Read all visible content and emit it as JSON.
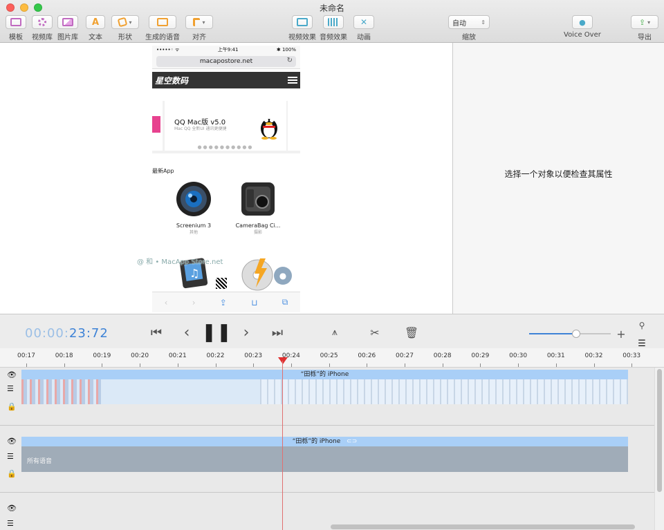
{
  "window": {
    "title": "未命名"
  },
  "toolbar": {
    "templates": "模板",
    "video_library": "视频库",
    "image_library": "图片库",
    "text": "文本",
    "shapes": "形状",
    "generated_voice": "生成的语音",
    "align": "对齐",
    "video_effects": "视频效果",
    "audio_effects": "音频效果",
    "animation": "动画",
    "zoom_value": "自动",
    "zoom": "缩放",
    "voice_over": "Voice Over",
    "export": "导出"
  },
  "inspector": {
    "empty_text": "选择一个对象以便检查其属性"
  },
  "phone": {
    "carrier": "•••••◦ ᯤ",
    "time": "上午9:41",
    "battery": "✱ 100%",
    "url": "macapostore.net",
    "brand": "星空数码",
    "banner_title": "QQ Mac版 v5.0",
    "banner_sub": "Mac QQ 全新UI 通讯更便捷",
    "section_title": "最新App",
    "apps": [
      {
        "name": "Screenium 3",
        "category": "其他"
      },
      {
        "name": "CameraBag Ci...",
        "category": "摄影"
      }
    ],
    "watermark": "@ 和 • MacApp.Store.net"
  },
  "controls": {
    "time_dim": "00:00:",
    "time_bright": "23:72",
    "zoom_fraction": 0.58
  },
  "ruler": {
    "ticks": [
      "00:17",
      "00:18",
      "00:19",
      "00:20",
      "00:21",
      "00:22",
      "00:23",
      "00:24",
      "00:25",
      "00:26",
      "00:27",
      "00:28",
      "00:29",
      "00:30",
      "00:31",
      "00:32",
      "00:33"
    ]
  },
  "tracks": {
    "video_clip_title": "“田栎”的 iPhone",
    "audio_clip_title": "“田栎”的 iPhone",
    "audio_clip_label": "所有语音"
  },
  "colors": {
    "accent": "#3d82d6",
    "clip_head": "#a9cff7",
    "playhead": "#e03030"
  }
}
